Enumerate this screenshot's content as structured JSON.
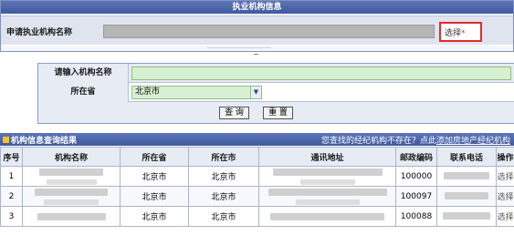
{
  "org_info": {
    "title": "执业机构信息",
    "apply_label": "申请执业机构名称",
    "select_link": "选择",
    "required_mark": "*"
  },
  "search_form": {
    "name_label": "请输入机构名称",
    "name_value": "",
    "province_label": "所在省",
    "province_value": "北京市",
    "query_button": "查 询",
    "reset_button": "重 置"
  },
  "results": {
    "title": "机构信息查询结果",
    "not_found_text": "您查找的经纪机构不存在？点此",
    "add_link": "添加房地产经纪机构",
    "columns": [
      "序号",
      "机构名称",
      "所在省",
      "所在市",
      "通讯地址",
      "邮政编码",
      "联系电话",
      "操作"
    ],
    "rows": [
      {
        "no": "1",
        "province": "北京市",
        "city": "北京市",
        "postcode": "100000",
        "action": "选择"
      },
      {
        "no": "2",
        "province": "北京市",
        "city": "北京市",
        "postcode": "100097",
        "action": "选择"
      },
      {
        "no": "3",
        "province": "北京市",
        "city": "北京市",
        "postcode": "100088",
        "action": "选择"
      }
    ]
  },
  "colors": {
    "header_blue": "#4a64aa",
    "row_bg": "#dfe4ef",
    "input_green": "#d8f0d2",
    "highlight_red": "#e02b2b",
    "icon_yellow": "#f3c325"
  }
}
